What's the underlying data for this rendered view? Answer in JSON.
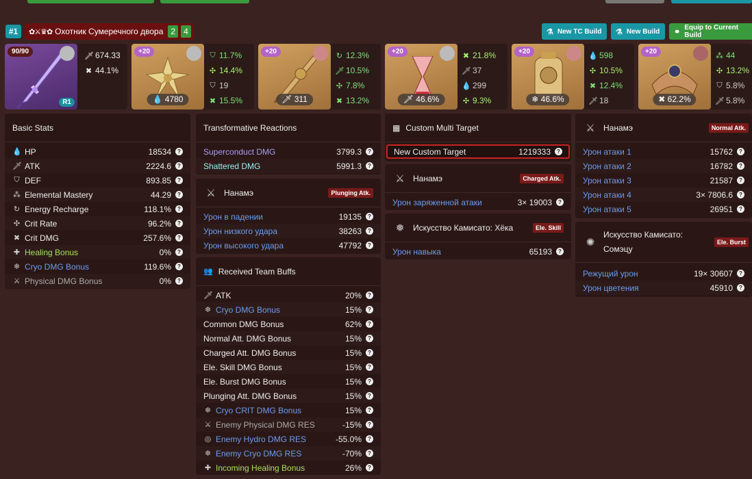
{
  "header": {
    "rank": "#1",
    "set_icons": "✿⚔♛✿",
    "set_name": "Охотник Сумеречного двора",
    "set_count_1": "2",
    "set_count_2": "4",
    "buttons": {
      "new_tc": "New TC Build",
      "new_build": "New Build",
      "equip": "Equip to Current Build"
    },
    "colors": {
      "teal": "#1a97a5",
      "green": "#3a9a3e",
      "rank_red": "#6b1010"
    }
  },
  "weapon": {
    "level": "90/90",
    "refine": "R1",
    "stats": [
      {
        "icon": "sword-icon",
        "value": "674.33"
      },
      {
        "icon": "crit-dmg-icon",
        "value": "44.1%"
      }
    ]
  },
  "artifacts": [
    {
      "level": "+20",
      "main": "4780",
      "main_icon": "hp-icon",
      "subs": [
        {
          "icon": "def-icon",
          "value": "11.7%",
          "color": "green"
        },
        {
          "icon": "crit-rate-icon",
          "value": "14.4%",
          "color": "bright"
        },
        {
          "icon": "def-icon",
          "value": "19",
          "color": "plain"
        },
        {
          "icon": "crit-dmg-icon",
          "value": "15.5%",
          "color": "green"
        }
      ]
    },
    {
      "level": "+20",
      "main": "311",
      "main_icon": "atk-icon",
      "subs": [
        {
          "icon": "er-icon",
          "value": "12.3%",
          "color": "green"
        },
        {
          "icon": "atk-icon",
          "value": "10.5%",
          "color": "green"
        },
        {
          "icon": "crit-rate-icon",
          "value": "7.8%",
          "color": "green"
        },
        {
          "icon": "crit-dmg-icon",
          "value": "13.2%",
          "color": "green"
        }
      ]
    },
    {
      "level": "+20",
      "main": "46.6%",
      "main_icon": "atk-icon",
      "subs": [
        {
          "icon": "crit-dmg-icon",
          "value": "21.8%",
          "color": "bright"
        },
        {
          "icon": "atk-icon",
          "value": "37",
          "color": "plain"
        },
        {
          "icon": "hp-icon",
          "value": "299",
          "color": "plain"
        },
        {
          "icon": "crit-rate-icon",
          "value": "9.3%",
          "color": "bright"
        }
      ]
    },
    {
      "level": "+20",
      "main": "46.6%",
      "main_icon": "cryo-icon",
      "subs": [
        {
          "icon": "hp-icon",
          "value": "598",
          "color": "green"
        },
        {
          "icon": "crit-rate-icon",
          "value": "10.5%",
          "color": "bright"
        },
        {
          "icon": "crit-dmg-icon",
          "value": "12.4%",
          "color": "green"
        },
        {
          "icon": "atk-icon",
          "value": "18",
          "color": "plain"
        }
      ]
    },
    {
      "level": "+20",
      "main": "62.2%",
      "main_icon": "crit-dmg-icon",
      "subs": [
        {
          "icon": "em-icon",
          "value": "44",
          "color": "green"
        },
        {
          "icon": "crit-rate-icon",
          "value": "13.2%",
          "color": "bright"
        },
        {
          "icon": "def-icon",
          "value": "5.8%",
          "color": "plain"
        },
        {
          "icon": "atk-icon",
          "value": "5.8%",
          "color": "plain"
        }
      ]
    }
  ],
  "basic_stats": {
    "title": "Basic Stats",
    "rows": [
      {
        "label": "HP",
        "value": "18534",
        "icon": "hp-icon"
      },
      {
        "label": "ATK",
        "value": "2224.6",
        "icon": "sword-icon"
      },
      {
        "label": "DEF",
        "value": "893.85",
        "icon": "shield-icon"
      },
      {
        "label": "Elemental Mastery",
        "value": "44.29",
        "icon": "em-icon"
      },
      {
        "label": "Energy Recharge",
        "value": "118.1%",
        "icon": "er-icon"
      },
      {
        "label": "Crit Rate",
        "value": "96.2%",
        "icon": "crit-rate-icon"
      },
      {
        "label": "Crit DMG",
        "value": "257.6%",
        "icon": "crit-dmg-icon"
      },
      {
        "label": "Healing Bonus",
        "value": "0%",
        "icon": "plus-icon"
      },
      {
        "label": "Cryo DMG Bonus",
        "value": "119.6%",
        "icon": "cryo-icon"
      },
      {
        "label": "Physical DMG Bonus",
        "value": "0%",
        "icon": "physical-icon"
      }
    ]
  },
  "transformative": {
    "title": "Transformative Reactions",
    "rows": [
      {
        "label": "Superconduct DMG",
        "value": "3799.3"
      },
      {
        "label": "Shattered DMG",
        "value": "5991.3"
      }
    ]
  },
  "plunging": {
    "title": "Нанамэ",
    "tag": "Plunging Atk.",
    "rows": [
      {
        "label": "Урон в падении",
        "value": "19135"
      },
      {
        "label": "Урон низкого удара",
        "value": "38263"
      },
      {
        "label": "Урон высокого удара",
        "value": "47792"
      }
    ]
  },
  "team_buffs": {
    "title": "Received Team Buffs",
    "rows": [
      {
        "label": "ATK",
        "value": "20%",
        "icon": "sword-icon"
      },
      {
        "label": "Cryo DMG Bonus",
        "value": "15%",
        "icon": "cryo-icon"
      },
      {
        "label": "Common DMG Bonus",
        "value": "62%",
        "icon": ""
      },
      {
        "label": "Normal Att. DMG Bonus",
        "value": "15%",
        "icon": ""
      },
      {
        "label": "Charged Att. DMG Bonus",
        "value": "15%",
        "icon": ""
      },
      {
        "label": "Ele. Skill DMG Bonus",
        "value": "15%",
        "icon": ""
      },
      {
        "label": "Ele. Burst DMG Bonus",
        "value": "15%",
        "icon": ""
      },
      {
        "label": "Plunging Att. DMG Bonus",
        "value": "15%",
        "icon": ""
      },
      {
        "label": "Cryo CRIT DMG Bonus",
        "value": "15%",
        "icon": "cryo-icon"
      },
      {
        "label": "Enemy Physical DMG RES",
        "value": "-15%",
        "icon": "physical-icon"
      },
      {
        "label": "Enemy Hydro DMG RES",
        "value": "-55.0%",
        "icon": "hydro-icon"
      },
      {
        "label": "Enemy Cryo DMG RES",
        "value": "-70%",
        "icon": "cryo-icon"
      },
      {
        "label": "Incoming Healing Bonus",
        "value": "26%",
        "icon": "plus-icon"
      }
    ]
  },
  "multi_target": {
    "title": "Custom Multi Target",
    "row": {
      "label": "New Custom Target",
      "value": "1219333"
    }
  },
  "charged": {
    "title": "Нанамэ",
    "tag": "Charged Atk.",
    "rows": [
      {
        "label": "Урон заряженной атаки",
        "value": "3× 19003"
      }
    ]
  },
  "skill": {
    "title": "Искусство Камисато: Хёка",
    "tag": "Ele. Skill",
    "rows": [
      {
        "label": "Урон навыка",
        "value": "65193"
      }
    ]
  },
  "normal": {
    "title": "Нанамэ",
    "tag": "Normal Atk.",
    "rows": [
      {
        "label": "Урон атаки 1",
        "value": "15762"
      },
      {
        "label": "Урон атаки 2",
        "value": "16782"
      },
      {
        "label": "Урон атаки 3",
        "value": "21587"
      },
      {
        "label": "Урон атаки 4",
        "value": "3× 7806.6"
      },
      {
        "label": "Урон атаки 5",
        "value": "26951"
      }
    ]
  },
  "burst": {
    "title_1": "Искусство Камисато:",
    "title_2": "Сомэцу",
    "tag": "Ele. Burst",
    "rows": [
      {
        "label": "Режущий урон",
        "value": "19× 30607"
      },
      {
        "label": "Урон цветения",
        "value": "45910"
      }
    ]
  }
}
